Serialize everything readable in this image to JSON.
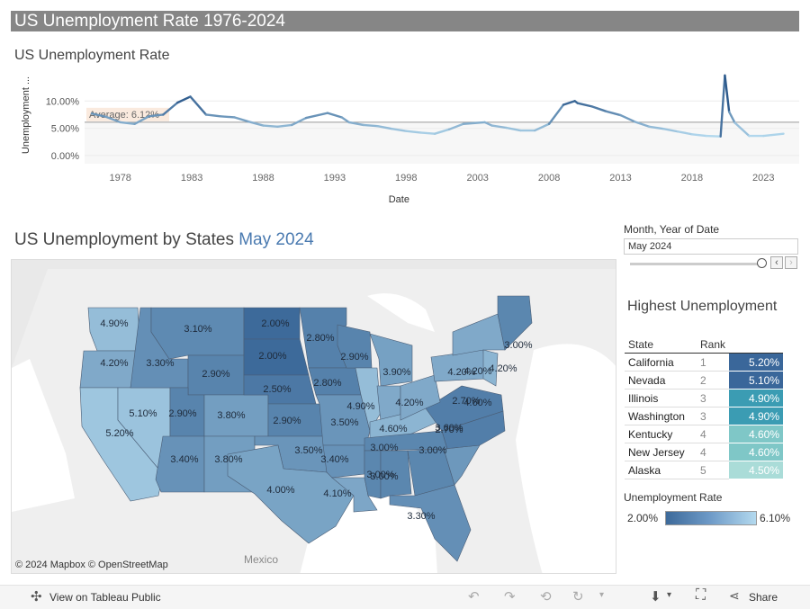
{
  "header": {
    "title": "US Unemployment Rate 1976-2024"
  },
  "line_section": {
    "title": "US Unemployment Rate"
  },
  "map_section": {
    "title_prefix": "US Unemployment by States",
    "title_highlight": "May 2024",
    "credits": "© 2024 Mapbox  © OpenStreetMap",
    "mexico_label": "Mexico"
  },
  "filter": {
    "label": "Month, Year of Date",
    "value": "May 2024",
    "prev_icon": "chevron-left-icon",
    "next_icon": "chevron-right-icon"
  },
  "highest": {
    "title": "Highest Unemployment",
    "columns": [
      "State",
      "Rank"
    ],
    "rows": [
      {
        "state": "California",
        "rank": "1",
        "value": "5.20%",
        "color": "#3a679a"
      },
      {
        "state": "Nevada",
        "rank": "2",
        "value": "5.10%",
        "color": "#3a679a"
      },
      {
        "state": "Illinois",
        "rank": "3",
        "value": "4.90%",
        "color": "#3b9cb3"
      },
      {
        "state": "Washington",
        "rank": "3",
        "value": "4.90%",
        "color": "#3b9cb3"
      },
      {
        "state": "Kentucky",
        "rank": "4",
        "value": "4.60%",
        "color": "#7fc7c7"
      },
      {
        "state": "New Jersey",
        "rank": "4",
        "value": "4.60%",
        "color": "#7fc7c7"
      },
      {
        "state": "Alaska",
        "rank": "5",
        "value": "4.50%",
        "color": "#aadcd8"
      }
    ]
  },
  "legend": {
    "title": "Unemployment Rate",
    "min": "2.00%",
    "max": "6.10%"
  },
  "footer": {
    "view_label": "View on Tableau Public",
    "share_label": "Share"
  },
  "chart_data": [
    {
      "type": "line",
      "title": "US Unemployment Rate",
      "xlabel": "Date",
      "ylabel": "Unemployment ...",
      "ylim": [
        -1.5,
        15
      ],
      "y_ticks": [
        "0.00%",
        "5.00%",
        "10.00%"
      ],
      "x_ticks": [
        "1978",
        "1983",
        "1988",
        "1993",
        "1998",
        "2003",
        "2008",
        "2013",
        "2018",
        "2023"
      ],
      "reference_line": {
        "label": "Average: 6.12%",
        "value": 6.12
      },
      "x": [
        1976,
        1977,
        1978,
        1979,
        1980,
        1981,
        1982,
        1982.9,
        1984,
        1985,
        1986,
        1987,
        1988,
        1989,
        1990,
        1991,
        1992.5,
        1993.5,
        1994,
        1995,
        1996,
        1997,
        1998,
        1999,
        2000,
        2001,
        2002,
        2003.5,
        2004,
        2005,
        2006,
        2007,
        2008,
        2009,
        2009.8,
        2010,
        2011,
        2012,
        2013,
        2014,
        2015,
        2016,
        2017,
        2018,
        2019,
        2020.0,
        2020.3,
        2020.6,
        2021,
        2022,
        2023,
        2024.4
      ],
      "values": [
        7.7,
        7.1,
        6.1,
        5.8,
        7.2,
        7.5,
        9.7,
        10.8,
        7.5,
        7.2,
        7.0,
        6.2,
        5.5,
        5.3,
        5.6,
        6.9,
        7.8,
        7.0,
        6.1,
        5.6,
        5.4,
        4.9,
        4.5,
        4.2,
        4.0,
        4.8,
        5.8,
        6.1,
        5.5,
        5.1,
        4.6,
        4.6,
        5.8,
        9.3,
        10.0,
        9.6,
        9.0,
        8.1,
        7.4,
        6.2,
        5.3,
        4.9,
        4.4,
        3.9,
        3.6,
        3.5,
        14.7,
        8.0,
        6.0,
        3.6,
        3.6,
        4.0
      ]
    },
    {
      "type": "map",
      "title": "US Unemployment by States May 2024",
      "categories": [
        "WA",
        "OR",
        "CA",
        "NV",
        "ID",
        "MT",
        "WY",
        "UT",
        "AZ",
        "CO",
        "NM",
        "ND",
        "SD",
        "NE",
        "KS",
        "OK",
        "TX",
        "MN",
        "IA",
        "MO",
        "AR",
        "LA",
        "WI",
        "IL",
        "MI",
        "IN",
        "KY",
        "TN",
        "MS",
        "AL",
        "GA",
        "FL",
        "SC",
        "NC",
        "VA",
        "OH",
        "PA",
        "NY",
        "ME",
        "NJ"
      ],
      "values": [
        4.9,
        4.2,
        5.2,
        5.1,
        3.3,
        3.1,
        2.9,
        2.9,
        3.4,
        3.8,
        3.8,
        2.0,
        2.0,
        2.5,
        2.9,
        3.5,
        4.0,
        2.8,
        2.8,
        3.5,
        3.4,
        4.1,
        2.9,
        4.9,
        3.9,
        4.2,
        4.6,
        3.0,
        3.0,
        3.0,
        3.0,
        3.3,
        3.6,
        2.7,
        2.7,
        4.2,
        4.2,
        4.2,
        3.0,
        4.6
      ]
    }
  ]
}
